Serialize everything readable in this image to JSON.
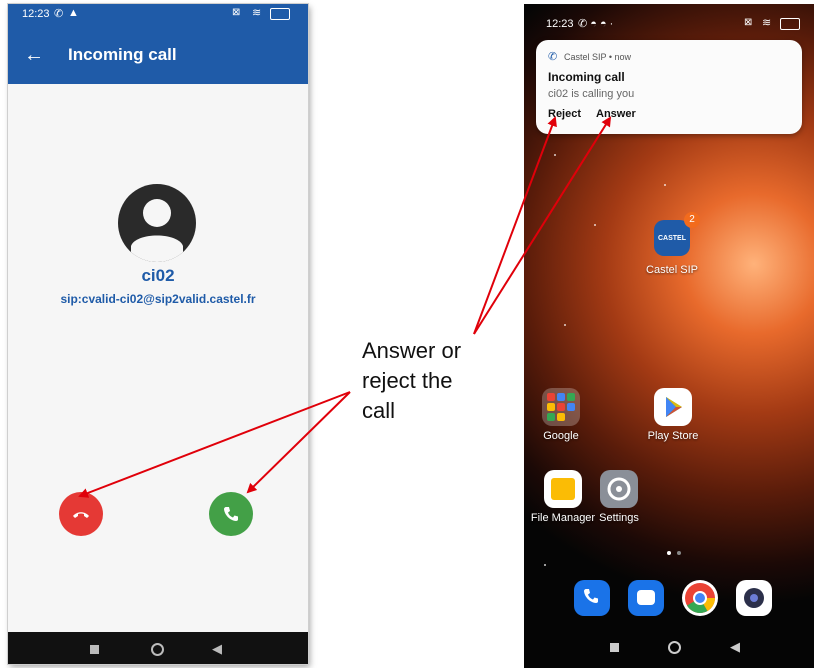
{
  "left_phone": {
    "status_time": "12:23",
    "appbar_title": "Incoming call",
    "caller_name": "ci02",
    "caller_sip": "sip:cvalid-ci02@sip2valid.castel.fr"
  },
  "right_phone": {
    "status_time": "12:23",
    "notification": {
      "app_line": "Castel SIP • now",
      "title": "Incoming call",
      "message": "ci02 is calling you",
      "reject_label": "Reject",
      "answer_label": "Answer"
    },
    "apps": {
      "castel_label": "Castel SIP",
      "castel_badge": "2",
      "castel_icon_text": "CASTEL",
      "google_label": "Google",
      "playstore_label": "Play Store",
      "filemanager_label": "File Manager",
      "settings_label": "Settings"
    }
  },
  "annotation": {
    "text_line1": "Answer or",
    "text_line2": "reject the",
    "text_line3": "call"
  },
  "colors": {
    "appbar_blue": "#1f5ba8",
    "reject_red": "#e53935",
    "answer_green": "#43a047",
    "arrow_red": "#e0000a"
  }
}
